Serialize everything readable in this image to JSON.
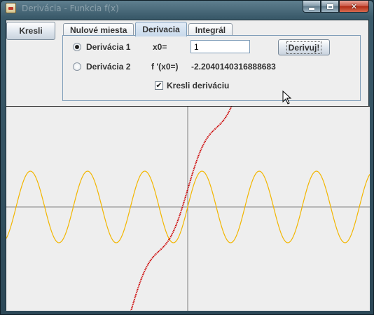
{
  "window": {
    "title": "Derivácia - Funkcia f(x)"
  },
  "toolbar": {
    "kresli_label": "Kresli"
  },
  "tabs": [
    {
      "label": "Nulové miesta",
      "active": false
    },
    {
      "label": "Derivacia",
      "active": true
    },
    {
      "label": "Integrál",
      "active": false
    }
  ],
  "derivative_panel": {
    "radio1_label": "Derivácia 1",
    "radio2_label": "Derivácia 2",
    "selected_radio": "Derivácia 1",
    "x0_label": "x0=",
    "x0_value": "1",
    "derivuj_label": "Derivuj!",
    "fprime_label": "f '(x0=)",
    "fprime_value": "-2.2040140316888683",
    "checkbox_label": "Kresli deriváciu",
    "checkbox_checked": true
  },
  "plot": {
    "background_color": "#eeeeee",
    "axis_color": "#808080",
    "sine_color": "#f2b600",
    "derivative_color": "#cc0000",
    "curves": [
      {
        "style": "solid"
      },
      {
        "style": "dotted"
      }
    ]
  },
  "icons": {
    "app": "java-cup-icon",
    "minimize": "minimize-icon",
    "maximize": "maximize-icon",
    "close": "close-icon",
    "cursor": "mouse-pointer-icon"
  }
}
